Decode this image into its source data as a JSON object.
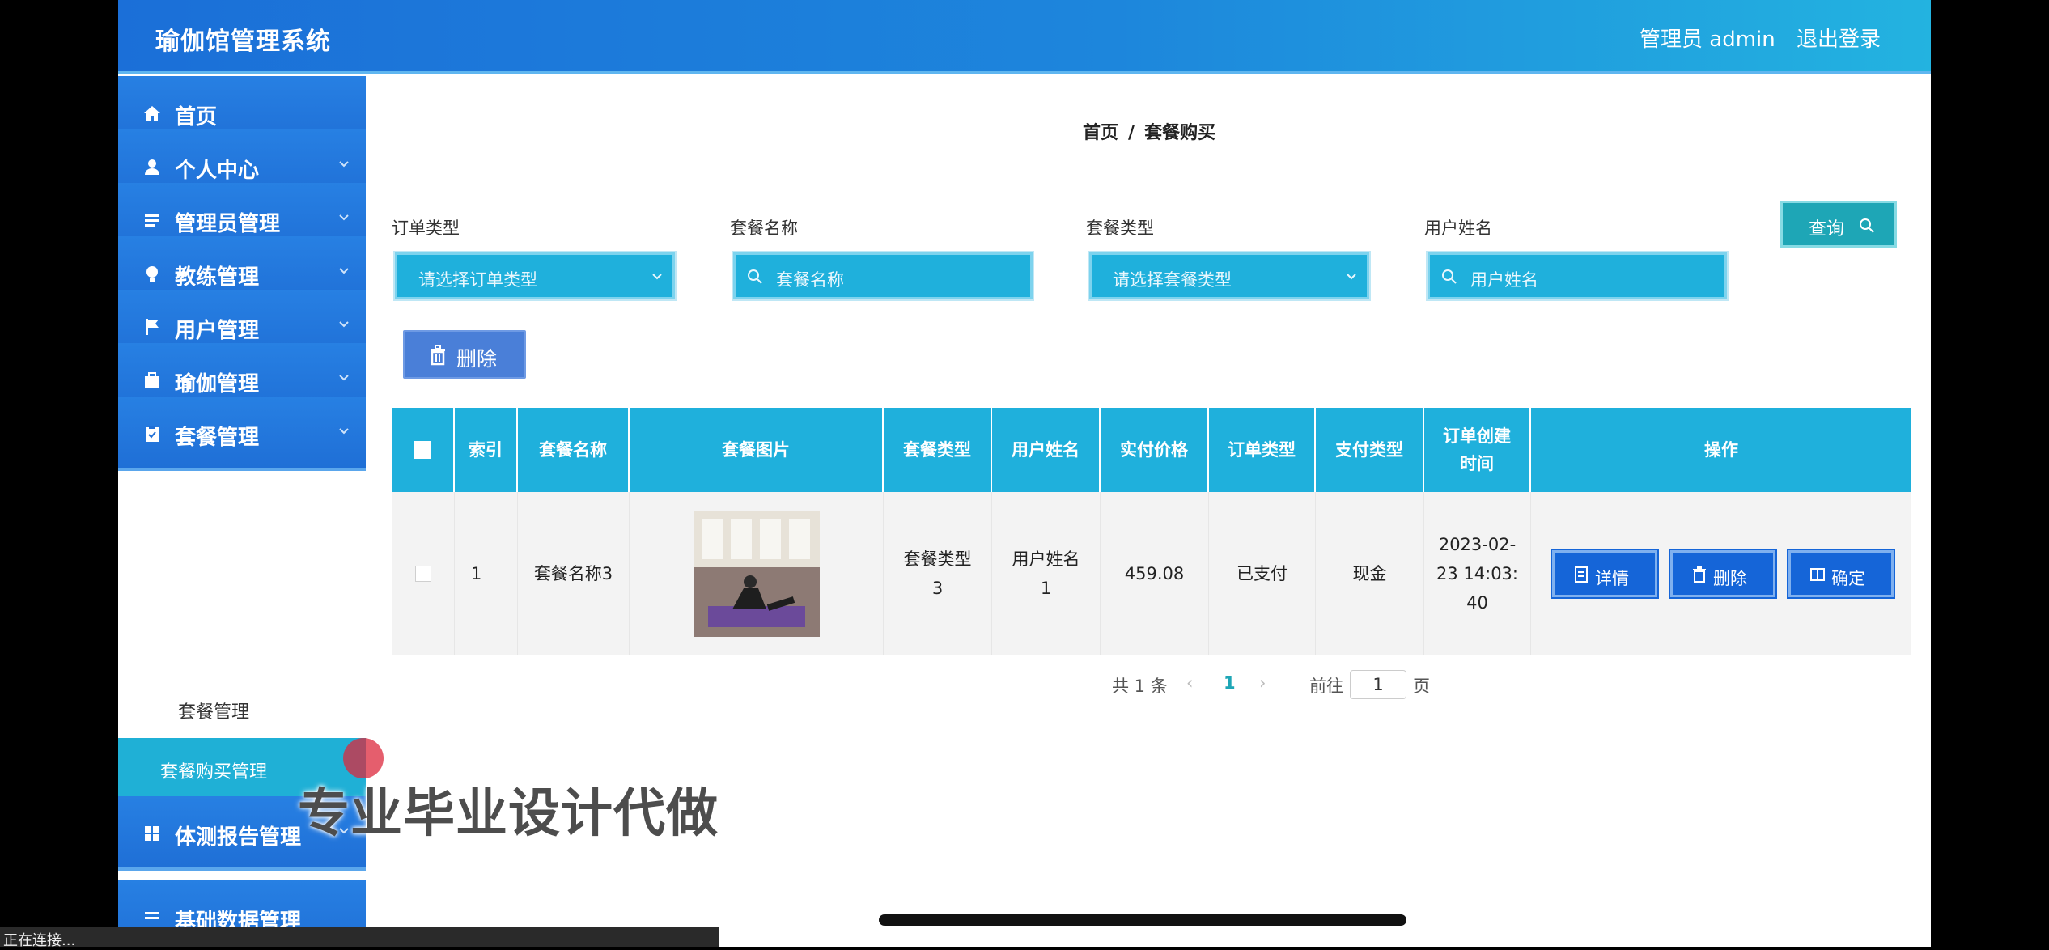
{
  "header": {
    "title": "瑜伽馆管理系统",
    "admin_label": "管理员 admin",
    "logout_label": "退出登录"
  },
  "sidebar": {
    "items": [
      {
        "label": "首页",
        "icon": "home-icon"
      },
      {
        "label": "个人中心",
        "icon": "user-icon"
      },
      {
        "label": "管理员管理",
        "icon": "list-icon"
      },
      {
        "label": "教练管理",
        "icon": "bulb-icon"
      },
      {
        "label": "用户管理",
        "icon": "flag-icon"
      },
      {
        "label": "瑜伽管理",
        "icon": "briefcase-icon"
      },
      {
        "label": "套餐管理",
        "icon": "clipboard-icon"
      },
      {
        "label": "体测报告管理",
        "icon": "grid-icon"
      },
      {
        "label": "基础数据管理",
        "icon": "list-icon"
      }
    ],
    "sub_items": [
      {
        "label": "套餐管理"
      },
      {
        "label": "套餐购买管理"
      }
    ]
  },
  "breadcrumb": {
    "home": "首页",
    "separator": "/",
    "current": "套餐购买"
  },
  "filters": {
    "order_type": {
      "label": "订单类型",
      "placeholder": "请选择订单类型"
    },
    "package_name": {
      "label": "套餐名称",
      "placeholder": "套餐名称"
    },
    "package_type": {
      "label": "套餐类型",
      "placeholder": "请选择套餐类型"
    },
    "user_name": {
      "label": "用户姓名",
      "placeholder": "用户姓名"
    }
  },
  "buttons": {
    "query": "查询",
    "bulk_delete": "删除"
  },
  "table": {
    "columns": [
      "索引",
      "套餐名称",
      "套餐图片",
      "套餐类型",
      "用户姓名",
      "实付价格",
      "订单类型",
      "支付类型",
      "订单创建时间",
      "操作"
    ],
    "column_lines": {
      "created_line1": "订单创建",
      "created_line2": "时间"
    },
    "rows": [
      {
        "index": "1",
        "package_name": "套餐名称3",
        "package_type_line1": "套餐类型",
        "package_type_line2": "3",
        "user_name_line1": "用户姓名",
        "user_name_line2": "1",
        "price": "459.08",
        "order_type": "已支付",
        "pay_type": "现金",
        "created_line1": "2023-02-",
        "created_line2": "23 14:03:",
        "created_line3": "40",
        "actions": {
          "detail": "详情",
          "delete": "删除",
          "confirm": "确定"
        }
      }
    ]
  },
  "pagination": {
    "total": "共 1 条",
    "current": "1",
    "goto": "前往",
    "page_value": "1",
    "page_suffix": "页",
    "prev": "‹",
    "next": "›"
  },
  "overlay": {
    "watermark": "专业毕业设计代做",
    "status": "正在连接..."
  },
  "colors": {
    "header": "#1b6fd8",
    "accent": "#1fb0dc",
    "action_button": "#1565d8"
  }
}
